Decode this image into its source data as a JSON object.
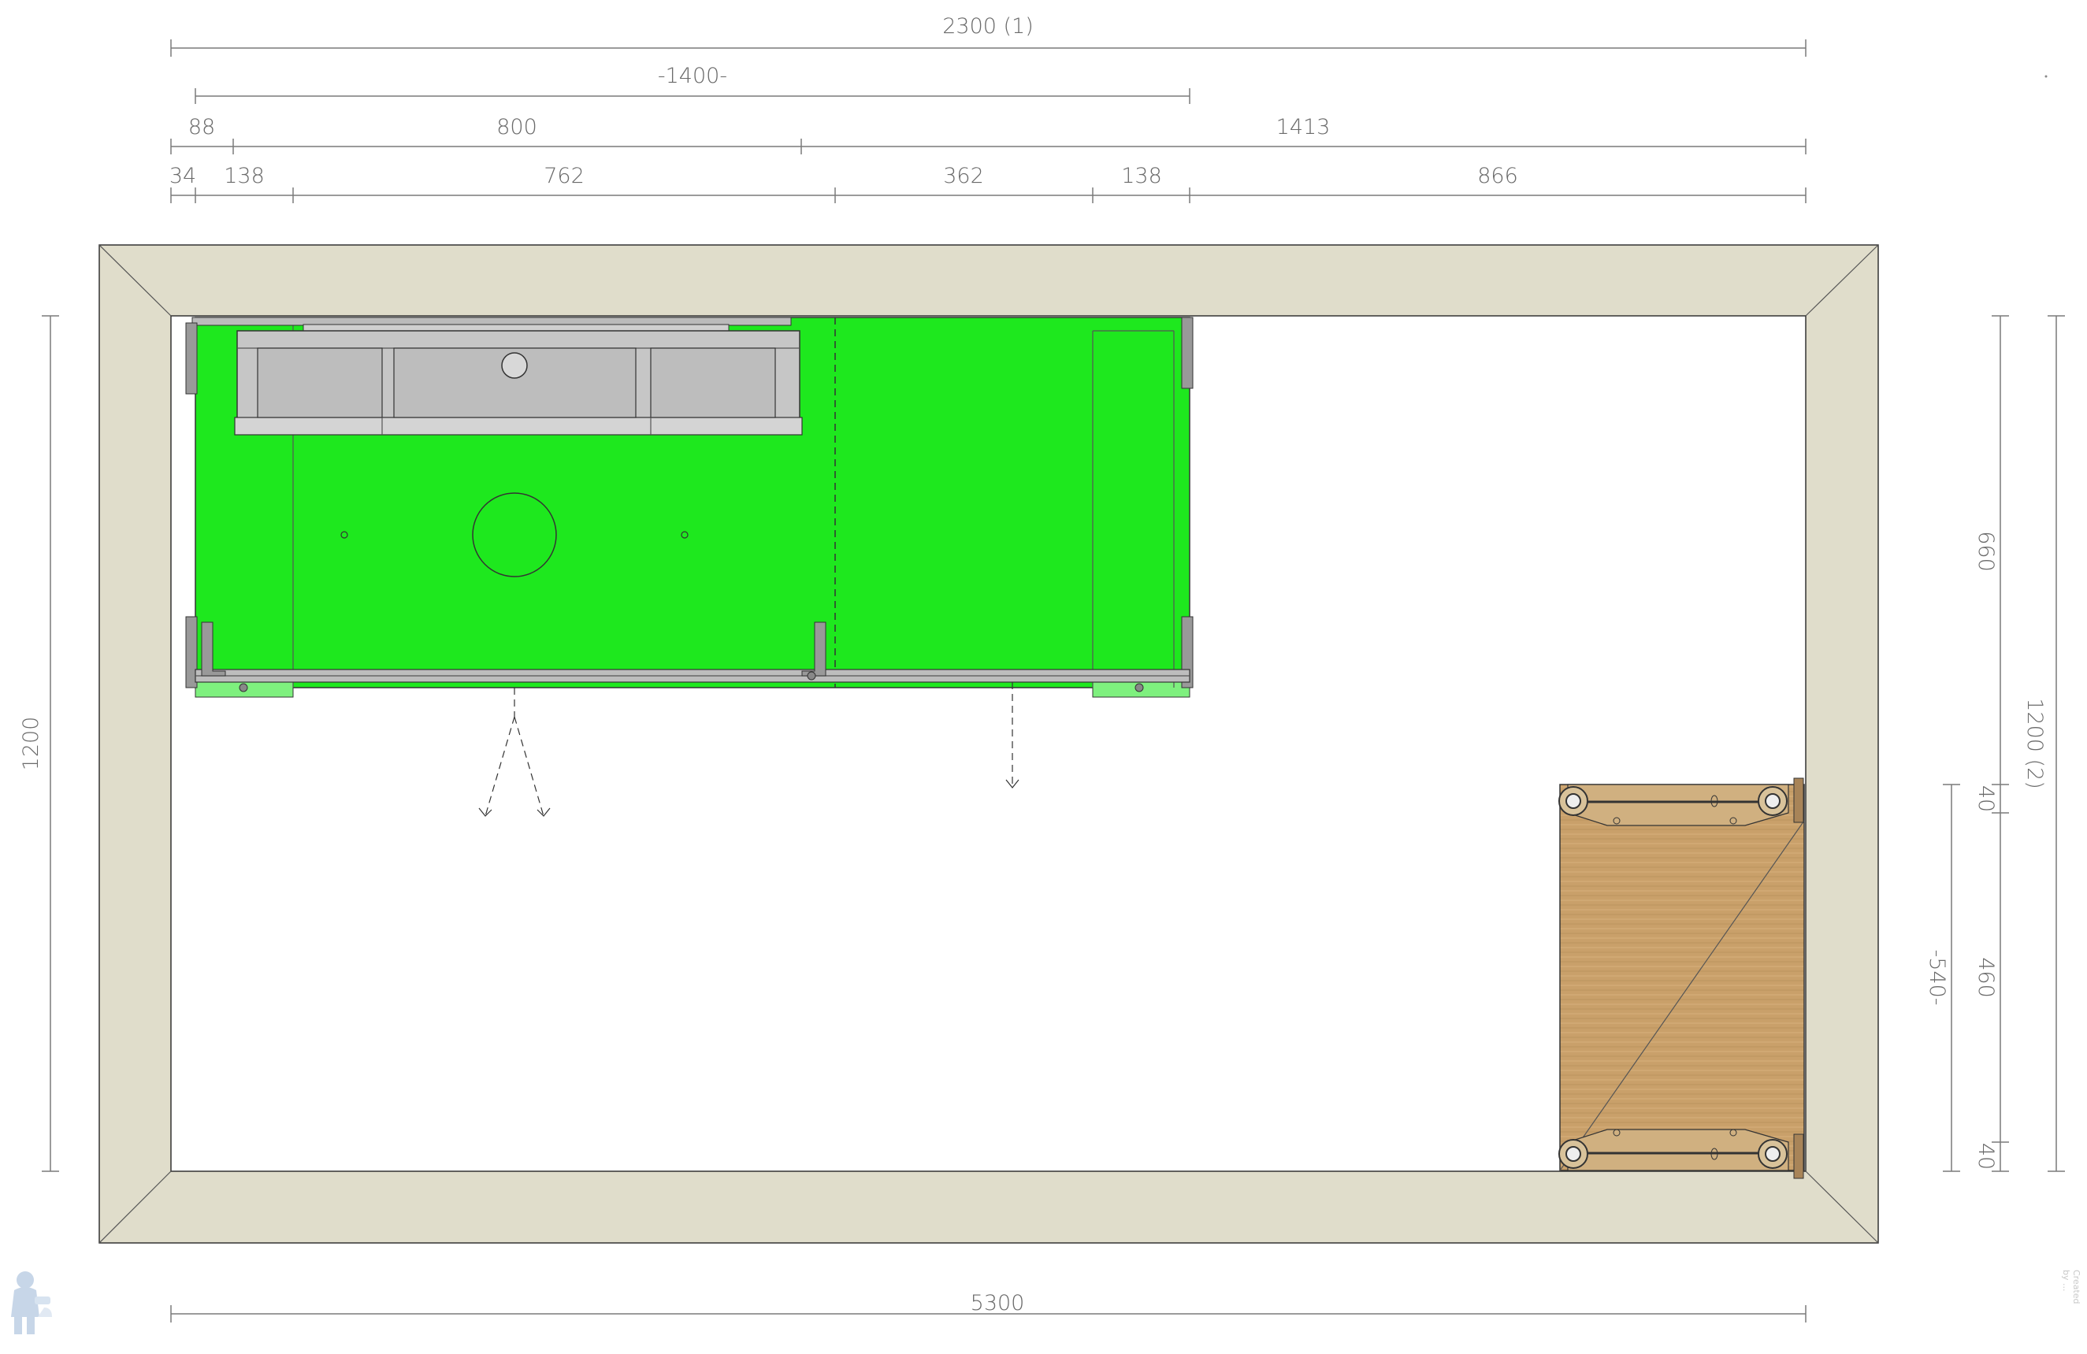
{
  "dimensions": {
    "top_total": "2300 (1)",
    "top_span": "-1400-",
    "row2": [
      "88",
      "800",
      "1413"
    ],
    "row3": [
      "34",
      "138",
      "762",
      "362",
      "138",
      "866"
    ],
    "left_height": "1200",
    "right_total": "1200 (2)",
    "right_660": "660",
    "right_span": "-540-",
    "right_40_top": "40",
    "right_460": "460",
    "right_40_bottom": "40",
    "bottom_width": "5300"
  },
  "colors": {
    "wall": "#e0ddcb",
    "cabinet_highlight": "#1ee81e",
    "sink": "#c6c6c6",
    "wood": "#c9a06a",
    "line": "#555555"
  },
  "watermark": {
    "icon": "plumber-logo-icon",
    "side_text": "Created by ..."
  }
}
